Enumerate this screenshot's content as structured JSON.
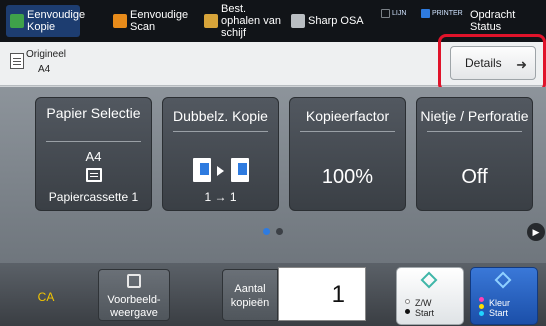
{
  "topbar": {
    "items": [
      {
        "label": "Eenvoudige Kopie",
        "active": true,
        "icon": "copy-icon",
        "icon_color": "#3fa24a"
      },
      {
        "label": "Eenvoudige Scan",
        "active": false,
        "icon": "scan-icon",
        "icon_color": "#e88b1a"
      },
      {
        "label": "Best. ophalen van schijf",
        "active": false,
        "icon": "folder-icon",
        "icon_color": "#d7a43a"
      },
      {
        "label": "Sharp OSA",
        "active": false,
        "icon": "osa-icon",
        "icon_color": "#b9bec2"
      }
    ],
    "led_line": "LIJN",
    "led_printer": "PRINTER",
    "job_status": "Opdracht Status"
  },
  "original": {
    "label": "Origineel",
    "size": "A4",
    "details_label": "Details",
    "details_arrow": "➜"
  },
  "tiles": [
    {
      "title": "Papier Selectie",
      "value": "A4",
      "sub": "Papiercassette 1",
      "icon": "paper-tray-icon"
    },
    {
      "title": "Dubbelz. Kopie",
      "value": "1 → 1",
      "icon": "duplex-icon"
    },
    {
      "title": "Kopieerfactor",
      "value": "100%"
    },
    {
      "title": "Nietje / Perforatie",
      "value": "Off"
    }
  ],
  "pager": {
    "active_color": "#2e7be0",
    "inactive_color": "#3c4046",
    "next_glyph": "▶"
  },
  "bottom": {
    "ca": "CA",
    "preview": "Voorbeeld-\nweergave",
    "count_label": "Aantal kopieën",
    "count_value": "1",
    "start_bw_line1": "Z/W",
    "start_bw_line2": "Start",
    "start_color_line1": "Kleur",
    "start_color_line2": "Start"
  },
  "colors": {
    "accent_blue": "#1b4fa9",
    "ca_yellow": "#f2c500",
    "highlight_red": "#e0132a"
  }
}
